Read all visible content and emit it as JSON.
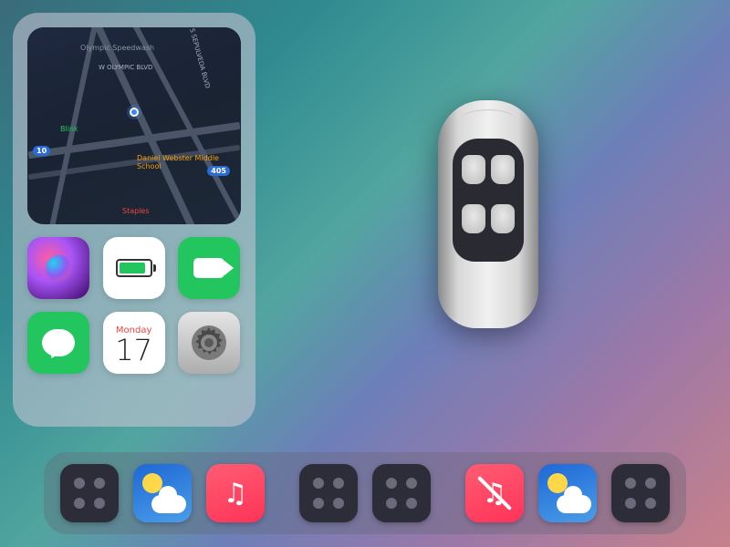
{
  "map": {
    "pois": {
      "speedwash": "Olympic Speedwash",
      "olympic": "W OLYMPIC BLVD",
      "sepulveda": "S SEPULVEDA BLVD",
      "school": "Daniel Webster Middle School",
      "staples": "Staples",
      "blink": "Blink",
      "hwy10": "10",
      "hwy405": "405"
    }
  },
  "apps": {
    "siri": "Siri",
    "battery": "Battery",
    "facetime": "FaceTime",
    "messages": "Messages",
    "calendar": {
      "day": "Monday",
      "date": "17"
    },
    "settings": "Settings"
  },
  "dock": {
    "items": [
      {
        "type": "placeholder"
      },
      {
        "type": "weather"
      },
      {
        "type": "music"
      },
      {
        "type": "placeholder"
      },
      {
        "type": "placeholder"
      },
      {
        "type": "music-muted"
      },
      {
        "type": "weather"
      },
      {
        "type": "placeholder"
      }
    ]
  }
}
